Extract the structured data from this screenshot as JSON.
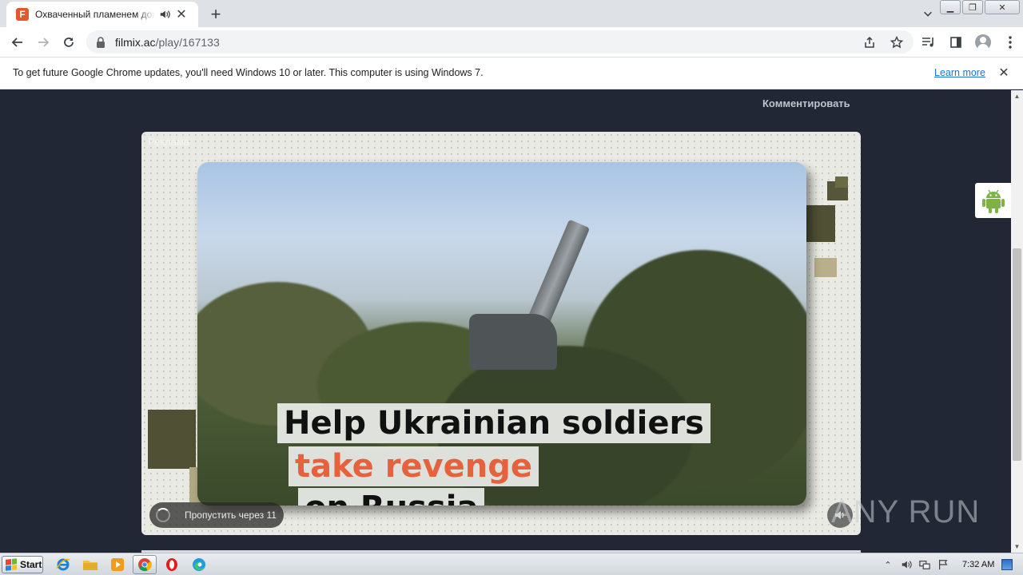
{
  "browser": {
    "tab_title": "Охваченный пламенем дом Ma",
    "favicon_letter": "F",
    "url_host": "filmix.ac",
    "url_path": "/play/167133"
  },
  "infobar": {
    "message": "To get future Google Chrome updates, you'll need Windows 10 or later. This computer is using Windows 7.",
    "link": "Learn more"
  },
  "page": {
    "comment_link": "Комментировать"
  },
  "ad": {
    "label": "Реклама",
    "caption_line1": "Help Ukrainian soldiers",
    "caption_line2": "take revenge",
    "caption_line3": "on Russia",
    "skip_label": "Пропустить через 11"
  },
  "watermark": {
    "text": "ANY RUN"
  },
  "taskbar": {
    "start_label": "Start",
    "clock": "7:32 AM"
  },
  "colors": {
    "page_bg": "#222735",
    "caption_red": "#e5623c",
    "link_blue": "#1a73e8"
  }
}
